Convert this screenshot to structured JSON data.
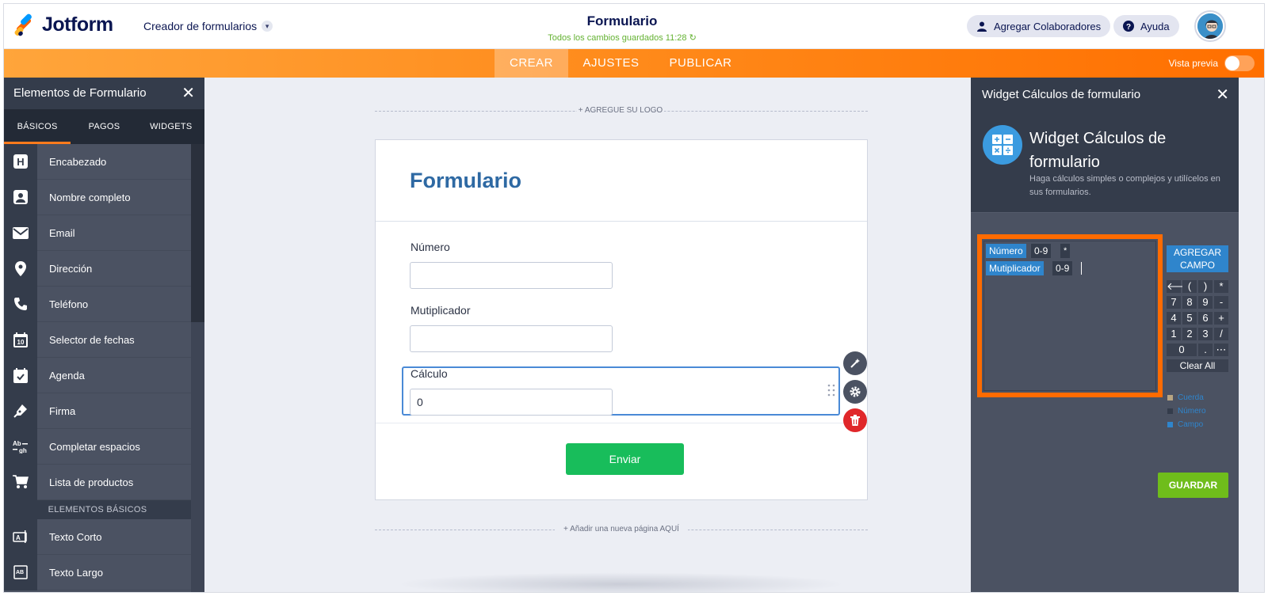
{
  "header": {
    "brand": "Jotform",
    "builder_label": "Creador de formularios",
    "form_title": "Formulario",
    "saved_status": "Todos los cambios guardados 11:28",
    "add_collaborators": "Agregar Colaboradores",
    "help": "Ayuda"
  },
  "nav": {
    "tabs": [
      {
        "label": "CREAR",
        "active": true
      },
      {
        "label": "AJUSTES",
        "active": false
      },
      {
        "label": "PUBLICAR",
        "active": false
      }
    ],
    "preview_label": "Vista previa",
    "preview_enabled": false
  },
  "left_panel": {
    "title": "Elementos de Formulario",
    "tabs": [
      {
        "label": "BÁSICOS",
        "active": true
      },
      {
        "label": "PAGOS",
        "active": false
      },
      {
        "label": "WIDGETS",
        "active": false
      }
    ],
    "items": [
      {
        "label": "Encabezado",
        "icon": "heading-icon"
      },
      {
        "label": "Nombre completo",
        "icon": "contact-icon"
      },
      {
        "label": "Email",
        "icon": "envelope-icon"
      },
      {
        "label": "Dirección",
        "icon": "location-pin-icon"
      },
      {
        "label": "Teléfono",
        "icon": "phone-icon"
      },
      {
        "label": "Selector de fechas",
        "icon": "calendar-icon"
      },
      {
        "label": "Agenda",
        "icon": "calendar-check-icon"
      },
      {
        "label": "Firma",
        "icon": "pen-icon"
      },
      {
        "label": "Completar espacios",
        "icon": "fill-blank-icon"
      },
      {
        "label": "Lista de productos",
        "icon": "cart-icon"
      }
    ],
    "section": "ELEMENTOS BÁSICOS",
    "basic_items": [
      {
        "label": "Texto Corto",
        "icon": "short-text-icon"
      },
      {
        "label": "Texto Largo",
        "icon": "long-text-icon"
      }
    ]
  },
  "canvas": {
    "add_logo": "+ AGREGUE SU LOGO",
    "form_heading": "Formulario",
    "fields": [
      {
        "label": "Número",
        "value": ""
      },
      {
        "label": "Mutiplicador",
        "value": ""
      },
      {
        "label": "Cálculo",
        "value": "0"
      }
    ],
    "submit": "Enviar",
    "add_page": "+ Añadir una nueva página AQUÍ"
  },
  "right_panel": {
    "title": "Widget Cálculos de formulario",
    "widget_name": "Widget Cálculos de formulario",
    "description": "Haga cálculos simples o complejos y utilícelos en sus formularios.",
    "formula_tokens": [
      {
        "text": "Número",
        "kind": "field"
      },
      {
        "text": "0-9",
        "kind": "number"
      },
      {
        "text": "*",
        "kind": "operator"
      },
      {
        "text": "Mutiplicador",
        "kind": "field"
      },
      {
        "text": "0-9",
        "kind": "number"
      }
    ],
    "add_field": "AGREGAR CAMPO",
    "keys": [
      "(",
      ")",
      "*",
      "7",
      "8",
      "9",
      "-",
      "4",
      "5",
      "6",
      "+",
      "1",
      "2",
      "3",
      "/",
      "0",
      ".",
      "⋯"
    ],
    "clear_all": "Clear All",
    "legend": [
      {
        "label": "Cuerda",
        "color": "#b8a582"
      },
      {
        "label": "Número",
        "color": "#343c4b"
      },
      {
        "label": "Campo",
        "color": "#2f85cc"
      }
    ],
    "save": "GUARDAR"
  },
  "colors": {
    "accent_orange": "#ff6b00",
    "submit_green": "#18bd5b",
    "save_green": "#6fbd1b",
    "field_blue": "#2f85cc",
    "heading_blue": "#2e69a3"
  }
}
